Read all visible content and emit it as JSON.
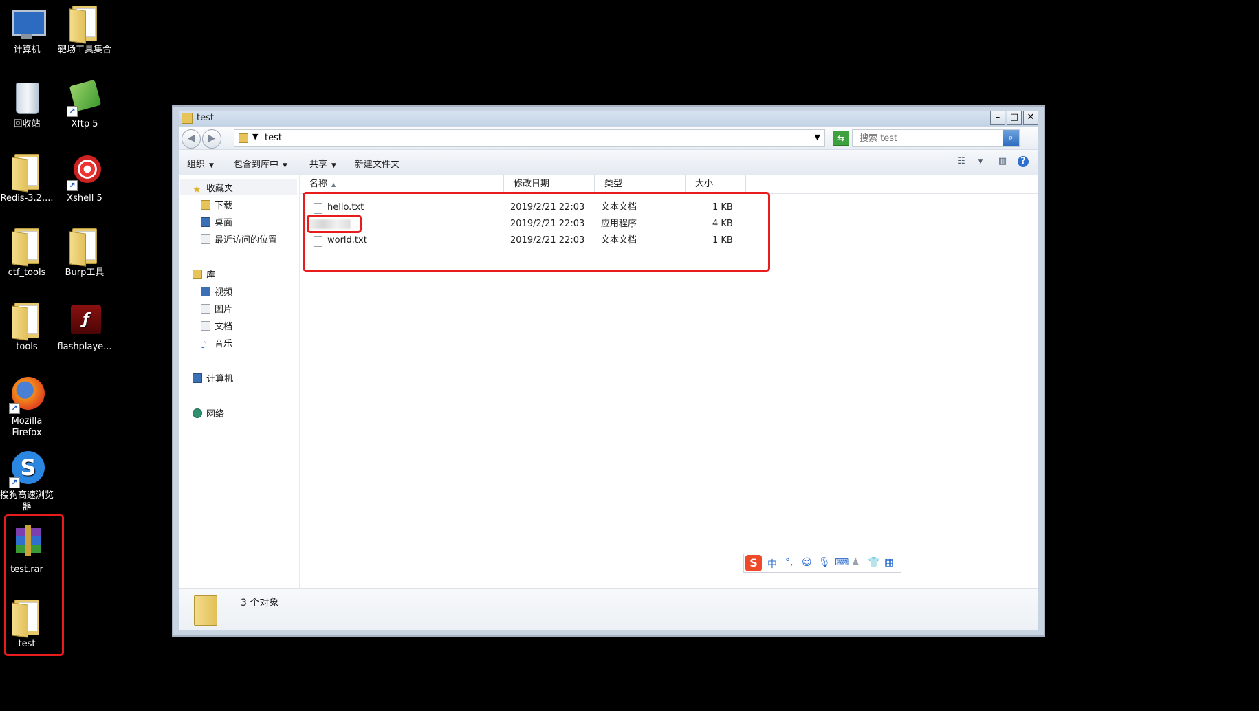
{
  "desktop": {
    "icons": [
      {
        "label": "计算机"
      },
      {
        "label": "靶场工具集合"
      },
      {
        "label": "回收站"
      },
      {
        "label": "Xftp 5"
      },
      {
        "label": "Redis-3.2...."
      },
      {
        "label": "Xshell 5"
      },
      {
        "label": "ctf_tools"
      },
      {
        "label": "Burp工具"
      },
      {
        "label": "tools"
      },
      {
        "label": "flashplaye..."
      },
      {
        "label": "Mozilla Firefox"
      },
      {
        "label": "搜狗高速浏览器"
      },
      {
        "label": "test.rar"
      },
      {
        "label": "test"
      }
    ]
  },
  "window": {
    "title": "test",
    "address_path": "test",
    "search_placeholder": "搜索 test",
    "toolbar": {
      "organize": "组织",
      "include_in_library": "包含到库中",
      "share": "共享",
      "new_folder": "新建文件夹"
    },
    "nav": {
      "favorites": "收藏夹",
      "downloads": "下载",
      "desktop": "桌面",
      "recent": "最近访问的位置",
      "libraries": "库",
      "videos": "视频",
      "pictures": "图片",
      "documents": "文档",
      "music": "音乐",
      "computer": "计算机",
      "network": "网络"
    },
    "columns": {
      "name": "名称",
      "modified": "修改日期",
      "type": "类型",
      "size": "大小"
    },
    "files": [
      {
        "name": "hello.txt",
        "modified": "2019/2/21 22:03",
        "type": "文本文档",
        "size": "1 KB"
      },
      {
        "name": "",
        "modified": "2019/2/21 22:03",
        "type": "应用程序",
        "size": "4 KB"
      },
      {
        "name": "world.txt",
        "modified": "2019/2/21 22:03",
        "type": "文本文档",
        "size": "1 KB"
      }
    ],
    "status_count": "3 个对象"
  },
  "ime_toolbar": {
    "logo": "S",
    "mode": "中",
    "punct": "°,",
    "icons": [
      "emoji-icon",
      "mic-icon",
      "keyboard-icon",
      "user-icon",
      "skin-icon",
      "grid-icon"
    ]
  },
  "highlight_color": "#e81c1c"
}
